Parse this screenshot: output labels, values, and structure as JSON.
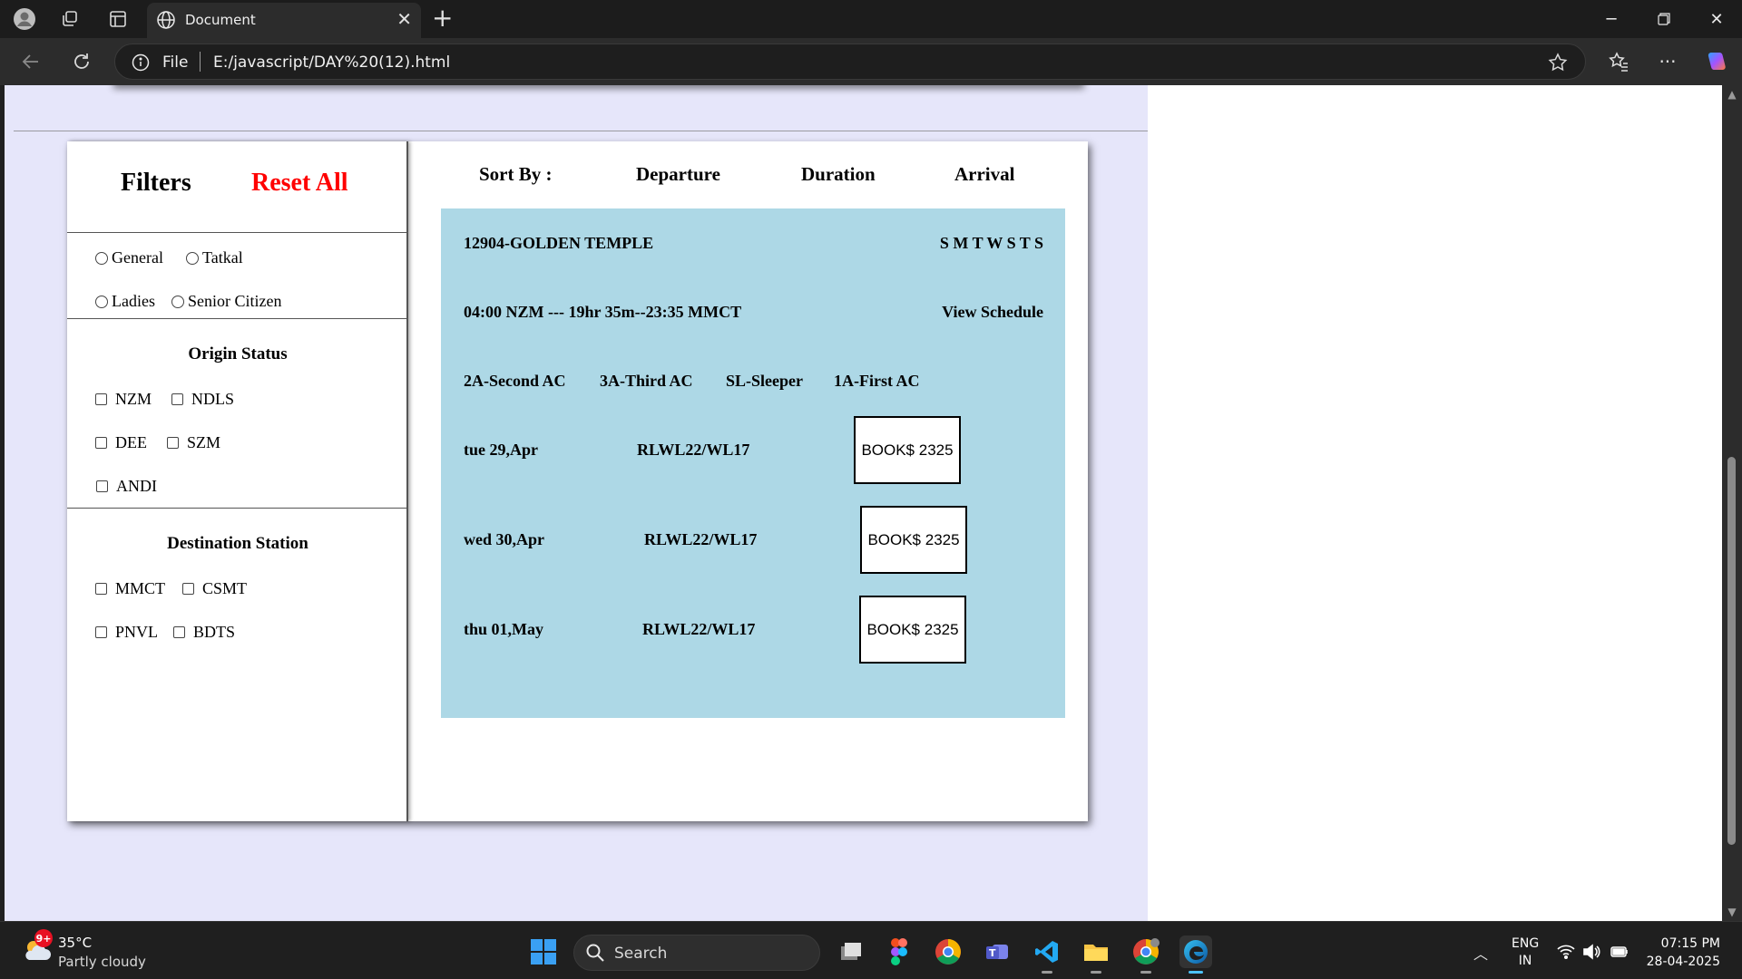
{
  "browser": {
    "tab_title": "Document",
    "address_scheme": "File",
    "address_url": "E:/javascript/DAY%20(12).html"
  },
  "filters": {
    "title": "Filters",
    "reset_label": "Reset All",
    "quota_options": [
      "General",
      "Tatkal",
      "Ladies",
      "Senior Citizen"
    ],
    "origin_title": "Origin Status",
    "origin_options": [
      "NZM",
      "NDLS",
      "DEE",
      "SZM",
      "ANDI"
    ],
    "destination_title": "Destination Station",
    "destination_options": [
      "MMCT",
      "CSMT",
      "PNVL",
      "BDTS"
    ]
  },
  "sort": {
    "label": "Sort By :",
    "options": [
      "Departure",
      "Duration",
      "Arrival"
    ]
  },
  "train": {
    "name": "12904-GOLDEN TEMPLE",
    "days": "S M T W S T S",
    "timing": "04:00 NZM --- 19hr 35m--23:35 MMCT",
    "schedule_link": "View Schedule",
    "classes": [
      "2A-Second AC",
      "3A-Third AC",
      "SL-Sleeper",
      "1A-First AC"
    ],
    "availability": [
      {
        "date": "tue 29,Apr",
        "status": "RLWL22/WL17",
        "book_label": "BOOK$ 2325"
      },
      {
        "date": "wed 30,Apr",
        "status": "RLWL22/WL17",
        "book_label": "BOOK$ 2325"
      },
      {
        "date": "thu 01,May",
        "status": "RLWL22/WL17",
        "book_label": "BOOK$ 2325"
      }
    ]
  },
  "taskbar": {
    "weather_badge": "9+",
    "temperature": "35°C",
    "condition": "Partly cloudy",
    "search_label": "Search",
    "lang_line1": "ENG",
    "lang_line2": "IN",
    "time": "07:15 PM",
    "date": "28-04-2025"
  }
}
